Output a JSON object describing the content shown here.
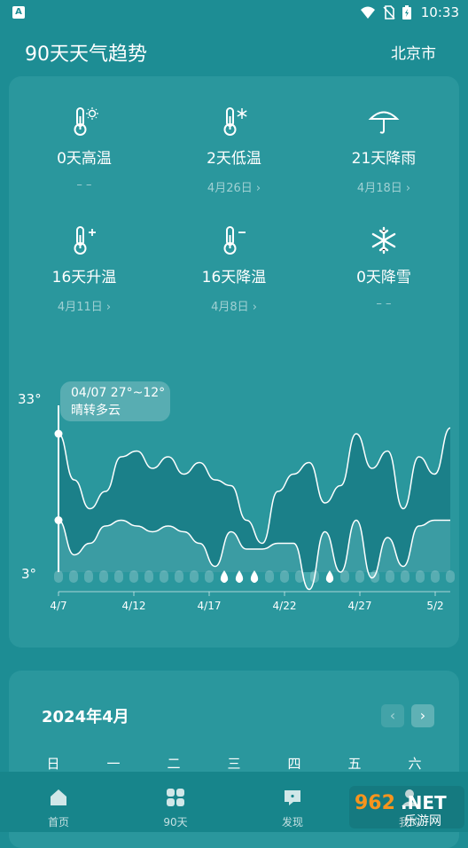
{
  "status": {
    "time": "10:33",
    "app_badge": "A"
  },
  "header": {
    "title": "90天天气趋势",
    "city": "北京市"
  },
  "stats": [
    {
      "label": "0天高温",
      "sub": "– –",
      "icon": "thermometer-sun-icon"
    },
    {
      "label": "2天低温",
      "sub": "4月26日 ›",
      "icon": "thermometer-snow-icon"
    },
    {
      "label": "21天降雨",
      "sub": "4月18日 ›",
      "icon": "umbrella-icon"
    },
    {
      "label": "16天升温",
      "sub": "4月11日 ›",
      "icon": "thermometer-up-icon"
    },
    {
      "label": "16天降温",
      "sub": "4月8日 ›",
      "icon": "thermometer-down-icon"
    },
    {
      "label": "0天降雪",
      "sub": "– –",
      "icon": "snowflake-icon"
    }
  ],
  "chart_data": {
    "type": "area",
    "ymax_label": "33°",
    "ymin_label": "3°",
    "ylim": [
      3,
      33
    ],
    "x_ticks": [
      "4/7",
      "4/12",
      "4/17",
      "4/22",
      "4/27",
      "5/2"
    ],
    "tooltip": {
      "line1": "04/07 27°~12°",
      "line2": "晴转多云"
    },
    "days": 27,
    "series": [
      {
        "values": [
          27,
          19,
          14,
          17,
          23,
          24,
          21,
          23,
          20,
          22,
          19,
          18,
          12,
          8,
          17,
          20,
          22,
          15,
          18,
          27,
          21,
          24,
          14,
          23,
          20,
          28
        ]
      },
      {
        "values": [
          12,
          6,
          8,
          11,
          12,
          11,
          10,
          11,
          10,
          8,
          4,
          10,
          7,
          7,
          8,
          8,
          0,
          10,
          3,
          12,
          2,
          9,
          4,
          11,
          12,
          12
        ]
      }
    ],
    "rain_days": [
      11,
      12,
      13,
      18
    ]
  },
  "calendar": {
    "month": "2024年4月",
    "weekdays": [
      "日",
      "一",
      "二",
      "三",
      "四",
      "五",
      "六"
    ]
  },
  "tabs": [
    {
      "label": "首页",
      "icon": "home-icon"
    },
    {
      "label": "90天",
      "icon": "grid-icon"
    },
    {
      "label": "发现",
      "icon": "message-icon"
    },
    {
      "label": "我的",
      "icon": "user-icon"
    }
  ],
  "colors": {
    "background": "#1d8d94",
    "card": "#2a979d",
    "tabbar": "#17858b"
  },
  "watermark": {
    "text1": "962",
    "text2": ".NET",
    "text3": "乐游网"
  }
}
